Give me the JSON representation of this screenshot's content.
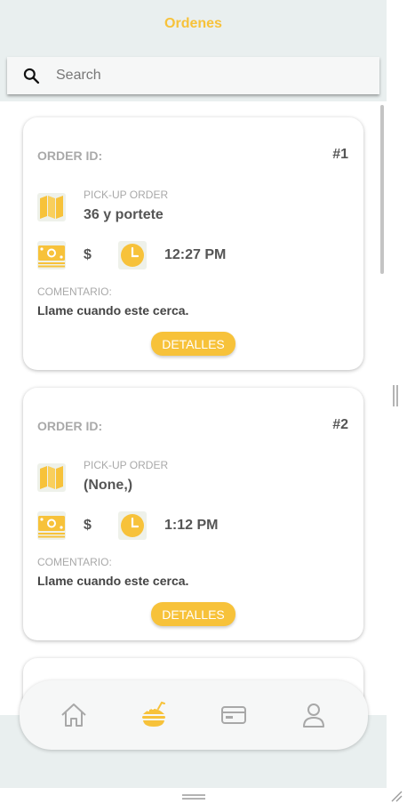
{
  "header": {
    "title": "Ordenes"
  },
  "search": {
    "placeholder": "Search"
  },
  "labels": {
    "order_id": "ORDER ID:",
    "pickup": "PICK-UP ORDER",
    "comment": "COMENTARIO:",
    "details_button": "DETALLES",
    "currency": "$"
  },
  "orders": [
    {
      "id": "#1",
      "pickup_value": "36 y portete",
      "time": "12:27 PM",
      "comment": "Llame cuando este cerca."
    },
    {
      "id": "#2",
      "pickup_value": "(None,)",
      "time": "1:12 PM",
      "comment": "Llame cuando este cerca."
    }
  ],
  "tabs": [
    {
      "icon": "home-icon"
    },
    {
      "icon": "food-icon",
      "active": true
    },
    {
      "icon": "card-icon"
    },
    {
      "icon": "user-icon"
    }
  ],
  "colors": {
    "accent": "#f7c23a",
    "icon_bg": "#eef1ea",
    "inactive_icon": "#a8a8a8"
  }
}
